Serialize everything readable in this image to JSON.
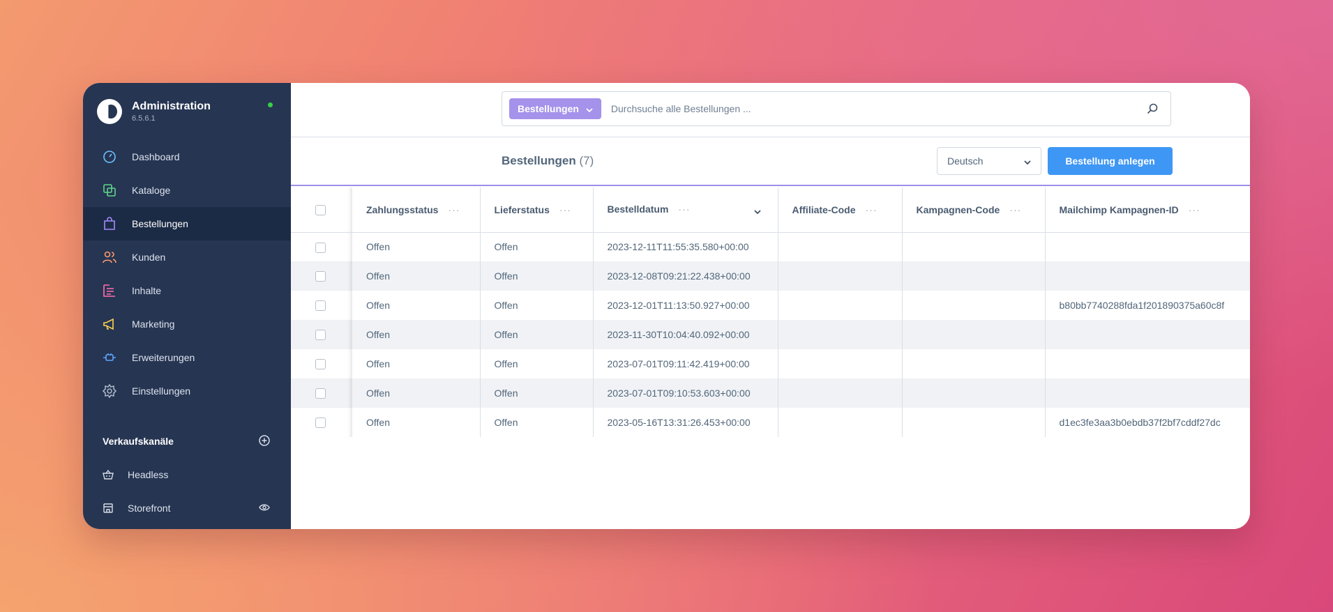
{
  "app": {
    "title": "Administration",
    "version": "6.5.6.1"
  },
  "nav": [
    {
      "label": "Dashboard",
      "icon": "dashboard-icon",
      "color": "#6fc2ff"
    },
    {
      "label": "Kataloge",
      "icon": "catalog-icon",
      "color": "#5fd68a"
    },
    {
      "label": "Bestellungen",
      "icon": "shopping-bag-icon",
      "color": "#a48cff",
      "active": true
    },
    {
      "label": "Kunden",
      "icon": "customers-icon",
      "color": "#ff9a6b"
    },
    {
      "label": "Inhalte",
      "icon": "content-icon",
      "color": "#ff6fb0"
    },
    {
      "label": "Marketing",
      "icon": "megaphone-icon",
      "color": "#ffd24d"
    },
    {
      "label": "Erweiterungen",
      "icon": "plugin-icon",
      "color": "#5aa8ff"
    },
    {
      "label": "Einstellungen",
      "icon": "gear-icon",
      "color": "#aab3c5"
    }
  ],
  "sales_channels": {
    "title": "Verkaufskanäle",
    "items": [
      {
        "label": "Headless",
        "icon": "basket-icon"
      },
      {
        "label": "Storefront",
        "icon": "storefront-icon"
      }
    ]
  },
  "search": {
    "type_label": "Bestellungen",
    "placeholder": "Durchsuche alle Bestellungen ..."
  },
  "header": {
    "title": "Bestellungen",
    "count": "(7)",
    "language": "Deutsch",
    "create_button": "Bestellung anlegen"
  },
  "table": {
    "columns": [
      "Zahlungsstatus",
      "Lieferstatus",
      "Bestelldatum",
      "Affiliate-Code",
      "Kampagnen-Code",
      "Mailchimp Kampagnen-ID"
    ],
    "rows": [
      {
        "payment": "Offen",
        "delivery": "Offen",
        "date": "2023-12-11T11:55:35.580+00:00",
        "affiliate": "",
        "campaign": "",
        "mailchimp": ""
      },
      {
        "payment": "Offen",
        "delivery": "Offen",
        "date": "2023-12-08T09:21:22.438+00:00",
        "affiliate": "",
        "campaign": "",
        "mailchimp": ""
      },
      {
        "payment": "Offen",
        "delivery": "Offen",
        "date": "2023-12-01T11:13:50.927+00:00",
        "affiliate": "",
        "campaign": "",
        "mailchimp": "b80bb7740288fda1f201890375a60c8f"
      },
      {
        "payment": "Offen",
        "delivery": "Offen",
        "date": "2023-11-30T10:04:40.092+00:00",
        "affiliate": "",
        "campaign": "",
        "mailchimp": ""
      },
      {
        "payment": "Offen",
        "delivery": "Offen",
        "date": "2023-07-01T09:11:42.419+00:00",
        "affiliate": "",
        "campaign": "",
        "mailchimp": ""
      },
      {
        "payment": "Offen",
        "delivery": "Offen",
        "date": "2023-07-01T09:10:53.603+00:00",
        "affiliate": "",
        "campaign": "",
        "mailchimp": ""
      },
      {
        "payment": "Offen",
        "delivery": "Offen",
        "date": "2023-05-16T13:31:26.453+00:00",
        "affiliate": "",
        "campaign": "",
        "mailchimp": "d1ec3fe3aa3b0ebdb37f2bf7cddf27dc"
      }
    ]
  }
}
